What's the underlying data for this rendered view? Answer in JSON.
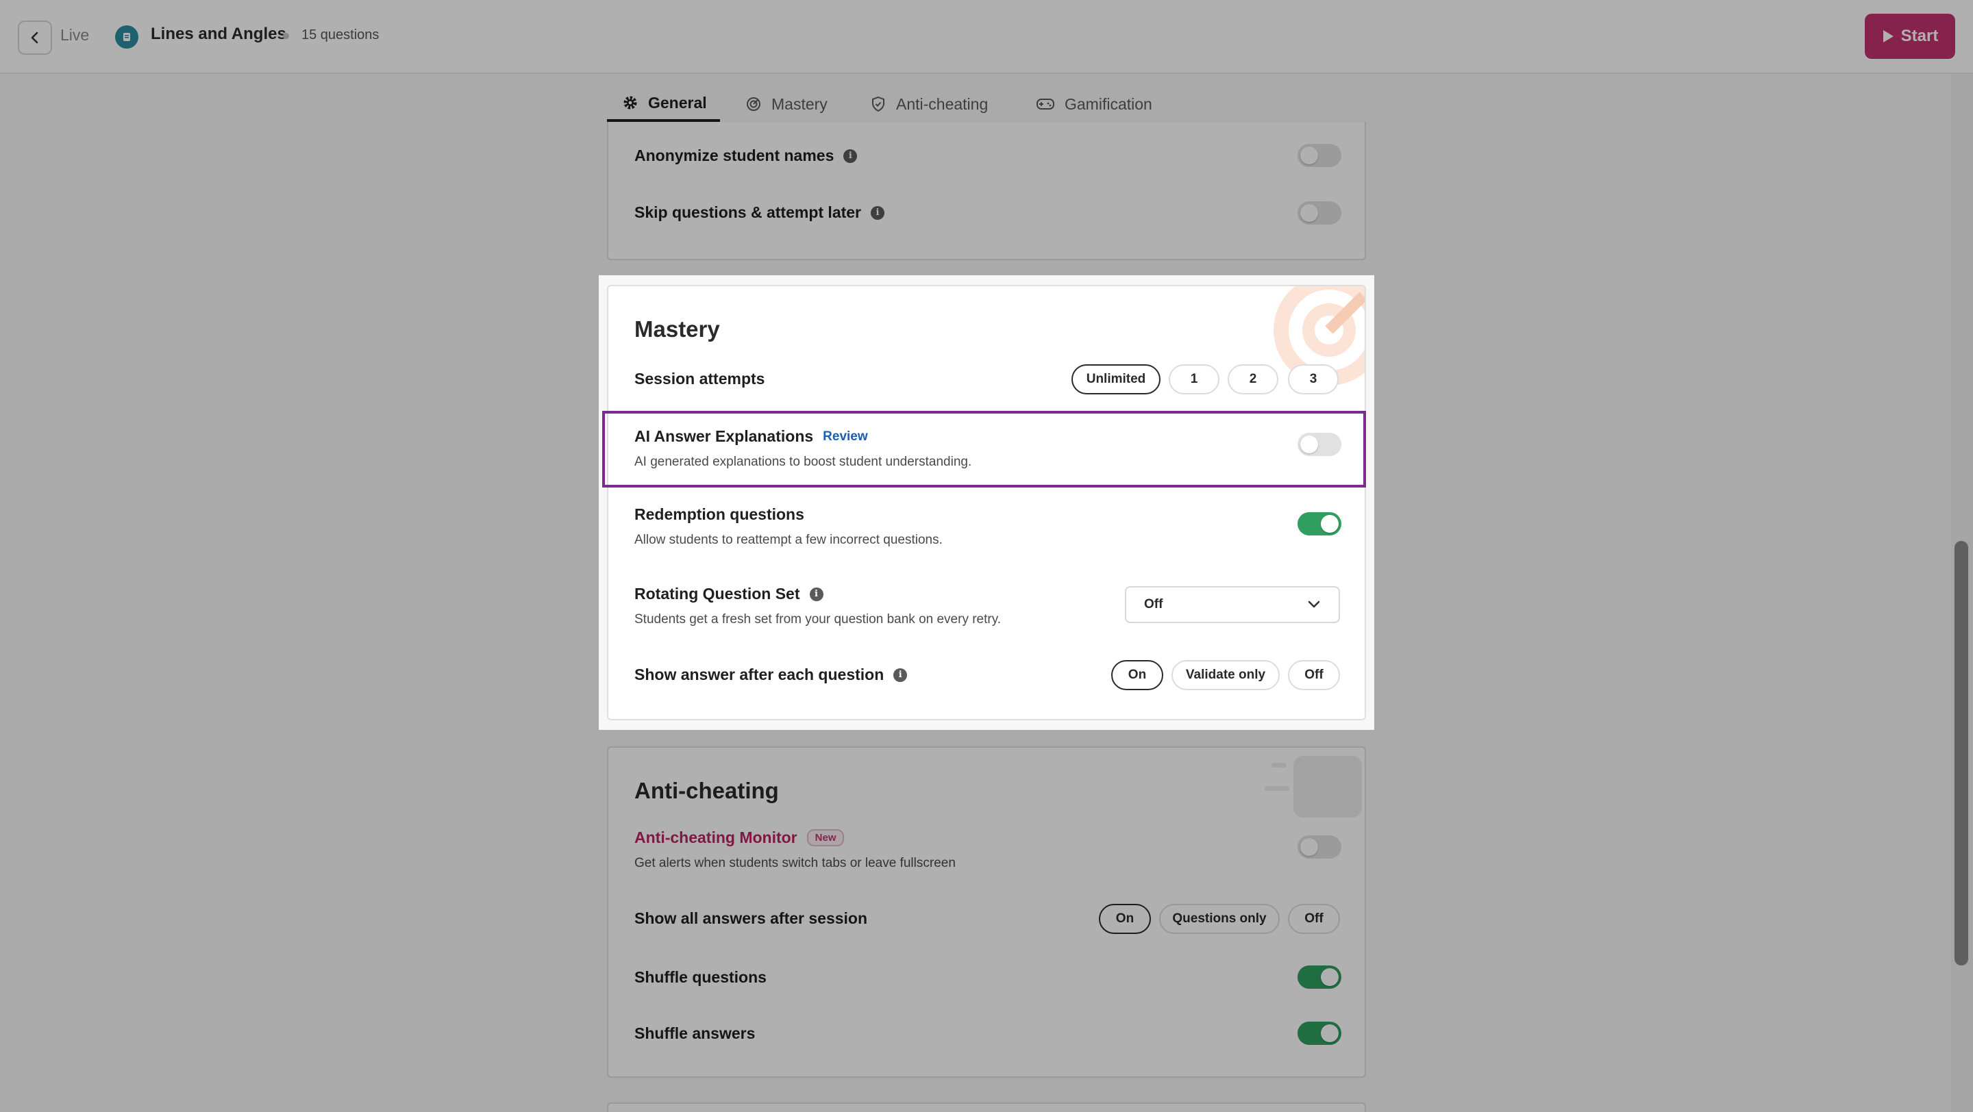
{
  "header": {
    "live_label": "Live",
    "quiz_title": "Lines and Angles",
    "question_count": "15 questions",
    "start_label": "Start",
    "brand_color": "#c2336f"
  },
  "tabs": [
    {
      "label": "General",
      "icon": "gear-icon",
      "active": true
    },
    {
      "label": "Mastery",
      "icon": "target-icon",
      "active": false
    },
    {
      "label": "Anti-cheating",
      "icon": "shield-icon",
      "active": false
    },
    {
      "label": "Gamification",
      "icon": "gamepad-icon",
      "active": false
    }
  ],
  "general": {
    "anonymize_label": "Anonymize student names",
    "anonymize_on": false,
    "skip_label": "Skip questions & attempt later",
    "skip_on": false
  },
  "mastery": {
    "title": "Mastery",
    "session_attempts": {
      "label": "Session attempts",
      "options": [
        "Unlimited",
        "1",
        "2",
        "3"
      ],
      "selected": "Unlimited"
    },
    "ai_explanations": {
      "label": "AI Answer Explanations",
      "review_label": "Review",
      "desc": "AI generated explanations to boost student understanding.",
      "on": false
    },
    "redemption": {
      "label": "Redemption questions",
      "desc": "Allow students to reattempt a few incorrect questions.",
      "on": true
    },
    "rotating": {
      "label": "Rotating Question Set",
      "desc": "Students get a fresh set from your question bank on every retry.",
      "value": "Off"
    },
    "show_answer": {
      "label": "Show answer after each question",
      "options": [
        "On",
        "Validate only",
        "Off"
      ],
      "selected": "On"
    }
  },
  "anticheating": {
    "title": "Anti-cheating",
    "monitor": {
      "label": "Anti-cheating Monitor",
      "badge": "New",
      "desc": "Get alerts when students switch tabs or leave fullscreen",
      "on": false
    },
    "show_all_answers": {
      "label": "Show all answers after session",
      "options": [
        "On",
        "Questions only",
        "Off"
      ],
      "selected": "On"
    },
    "shuffle_questions": {
      "label": "Shuffle questions",
      "on": true
    },
    "shuffle_answers": {
      "label": "Shuffle answers",
      "on": true
    }
  },
  "colors": {
    "toggle_on": "#2f9e5f",
    "highlight": "#7b2a8e",
    "link": "#1a5fb4"
  }
}
